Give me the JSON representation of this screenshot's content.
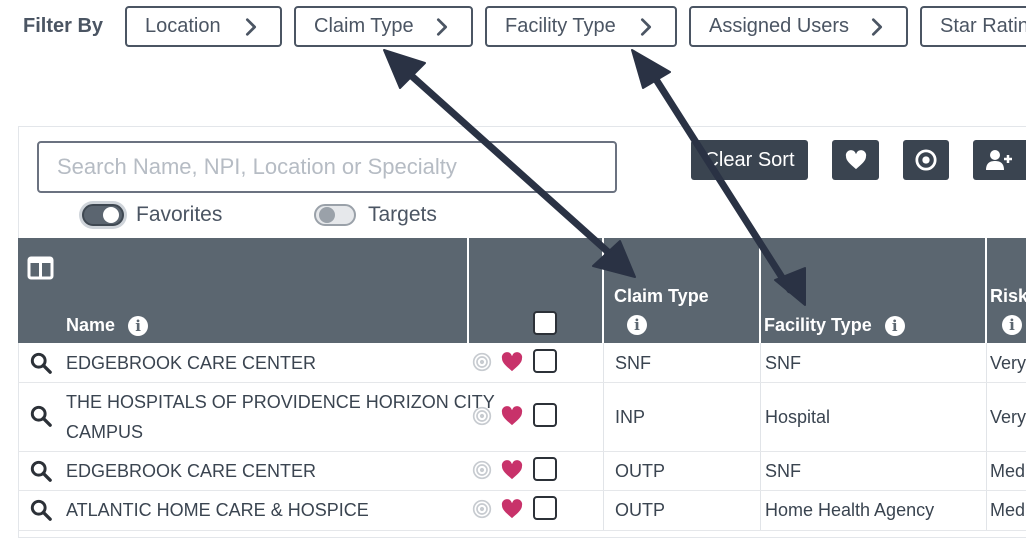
{
  "filter": {
    "label": "Filter By",
    "buttons": [
      "Location",
      "Claim Type",
      "Facility Type",
      "Assigned Users",
      "Star Ratin"
    ]
  },
  "search": {
    "placeholder": "Search Name, NPI, Location or Specialty"
  },
  "toggles": {
    "favorites": "Favorites",
    "targets": "Targets"
  },
  "actions": {
    "clear_sort": "Clear Sort"
  },
  "columns": {
    "name": "Name",
    "claim_type": "Claim Type",
    "facility_type": "Facility Type",
    "risk": "Risk"
  },
  "rows": [
    {
      "name": "EDGEBROOK CARE CENTER",
      "name2": "",
      "claim": "SNF",
      "facility": "SNF",
      "risk": "Very"
    },
    {
      "name": "THE HOSPITALS OF PROVIDENCE HORIZON CITY",
      "name2": "CAMPUS",
      "claim": "INP",
      "facility": "Hospital",
      "risk": "Very"
    },
    {
      "name": "EDGEBROOK CARE CENTER",
      "name2": "",
      "claim": "OUTP",
      "facility": "SNF",
      "risk": "Medi"
    },
    {
      "name": "ATLANTIC HOME CARE & HOSPICE",
      "name2": "",
      "claim": "OUTP",
      "facility": "Home Health Agency",
      "risk": "Medi"
    }
  ],
  "colors": {
    "header": "#5b6670",
    "dark_button": "#3a4450",
    "heart": "#c8326a",
    "arrow": "#2a3244"
  },
  "icons": [
    "chevron-right-icon",
    "heart-icon",
    "target-icon",
    "add-user-icon",
    "columns-icon",
    "info-icon",
    "search-icon"
  ]
}
